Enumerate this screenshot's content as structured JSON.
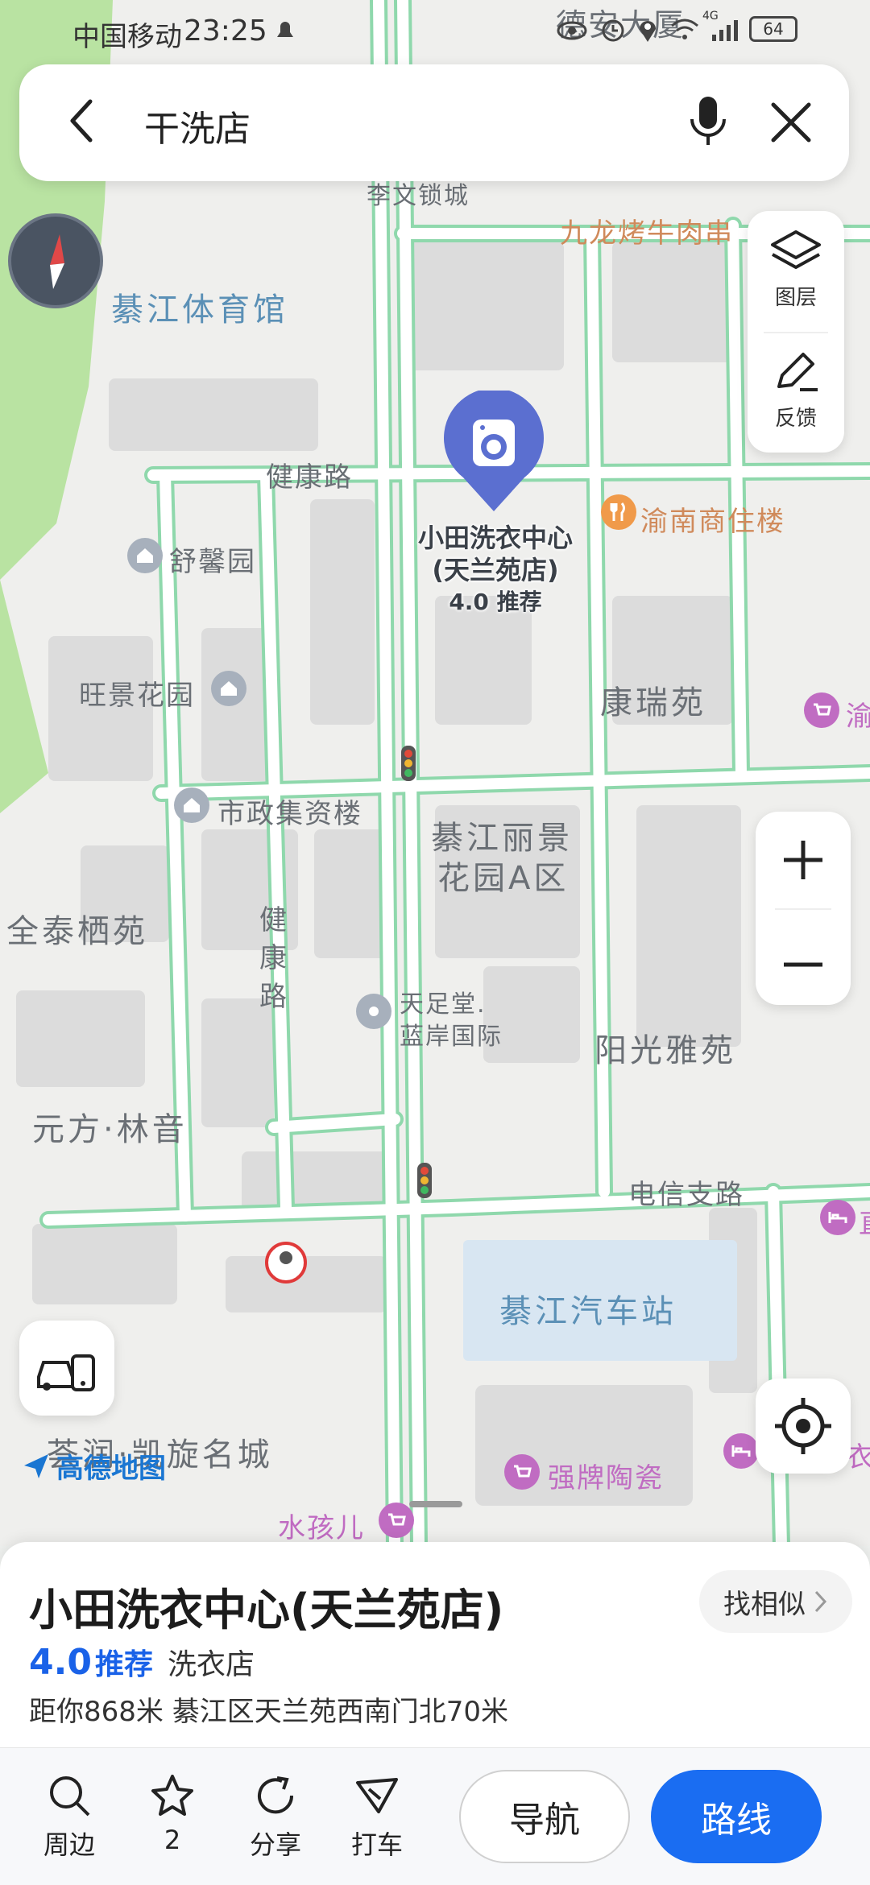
{
  "status_bar": {
    "carrier": "中国移动",
    "time": "23:25",
    "network": "4G",
    "battery": "64"
  },
  "search": {
    "query": "干洗店"
  },
  "map": {
    "labels": {
      "gym": "綦江体育馆",
      "li_wen": "李文锁城",
      "bbq": "九龙烤牛肉串",
      "jiankang_road": "健康路",
      "yunan": "渝南商住楼",
      "shuxin": "舒馨园",
      "wangjing": "旺景花园",
      "kangrui": "康瑞苑",
      "yu_right": "渝",
      "shizheng": "市政集资楼",
      "qj_lijing": "綦江丽景",
      "huayuan_a": "花园A区",
      "quantai": "全泰栖苑",
      "jiankang_v1": "健",
      "jiankang_v2": "康",
      "jiankang_v3": "路",
      "tianzutang1": "天足堂.",
      "tianzutang2": "蓝岸国际",
      "yangguang": "阳光雅苑",
      "yuanfang": "元方·林音",
      "dianxin_road": "电信支路",
      "bus_station": "綦江汽车站",
      "kairun": "荟润·凯旋名城",
      "qiangpai": "强牌陶瓷",
      "shuihaier": "水孩儿",
      "dean": "德安大厦",
      "right_edge1": "直",
      "right_edge2": "衣"
    },
    "marker": {
      "name_line1": "小田洗衣中心",
      "name_line2": "(天兰苑店)",
      "rating": "4.0 推荐"
    },
    "layer_label": "图层",
    "feedback_label": "反馈",
    "logo": "高德地图"
  },
  "poi": {
    "title": "小田洗衣中心(天兰苑店)",
    "rating": "4.0",
    "rating_text": "推荐",
    "category": "洗衣店",
    "address": "距你868米  綦江区天兰苑西南门北70米",
    "similar_label": "找相似"
  },
  "actions": {
    "nearby": "周边",
    "favorite": "2",
    "share": "分享",
    "taxi": "打车",
    "navigate": "导航",
    "route": "路线"
  },
  "colors": {
    "accent": "#1a6df2",
    "marker": "#5b6fd0",
    "road_outline": "#8fd8ac"
  }
}
